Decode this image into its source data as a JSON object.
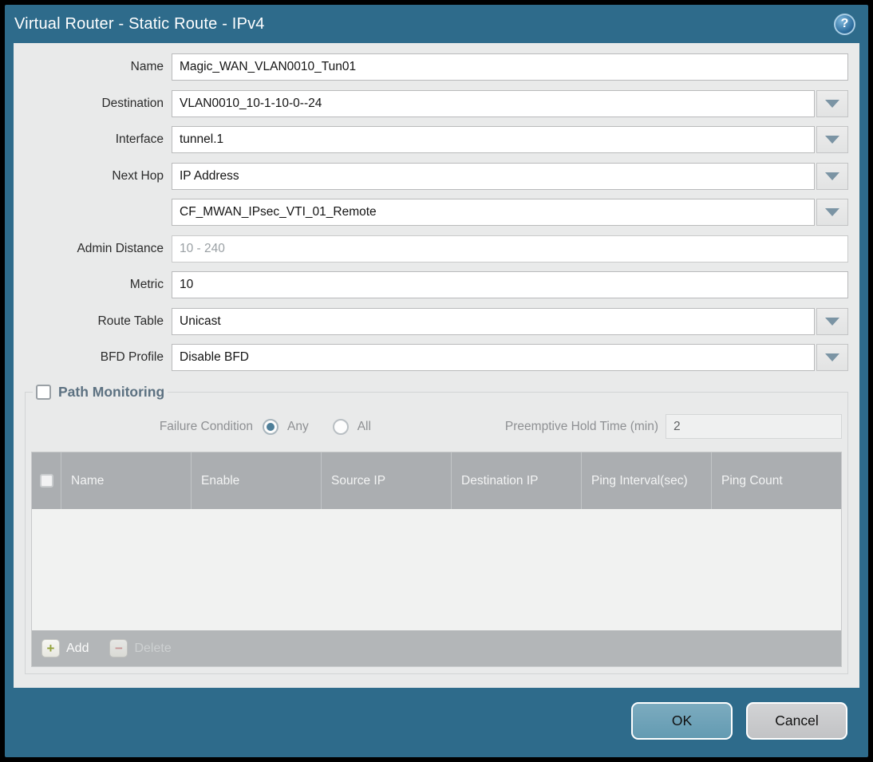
{
  "title_bar": {
    "title": "Virtual Router - Static Route - IPv4",
    "help_glyph": "?"
  },
  "form": {
    "name": {
      "label": "Name",
      "value": "Magic_WAN_VLAN0010_Tun01"
    },
    "destination": {
      "label": "Destination",
      "value": "VLAN0010_10-1-10-0--24"
    },
    "interface": {
      "label": "Interface",
      "value": "tunnel.1"
    },
    "next_hop": {
      "label": "Next Hop",
      "value": "IP Address"
    },
    "next_hop_value": {
      "value": "CF_MWAN_IPsec_VTI_01_Remote"
    },
    "admin_distance": {
      "label": "Admin Distance",
      "placeholder": "10 - 240"
    },
    "metric": {
      "label": "Metric",
      "value": "10"
    },
    "route_table": {
      "label": "Route Table",
      "value": "Unicast"
    },
    "bfd_profile": {
      "label": "BFD Profile",
      "value": "Disable BFD"
    }
  },
  "path_monitoring": {
    "title": "Path Monitoring",
    "enabled": false,
    "failure_condition": {
      "label": "Failure Condition",
      "options": [
        {
          "label": "Any",
          "selected": true
        },
        {
          "label": "All",
          "selected": false
        }
      ]
    },
    "preemptive_hold_time": {
      "label": "Preemptive Hold Time (min)",
      "value": "2"
    },
    "table": {
      "columns": [
        "Name",
        "Enable",
        "Source IP",
        "Destination IP",
        "Ping Interval(sec)",
        "Ping Count"
      ],
      "rows": []
    },
    "actions": {
      "add": "Add",
      "delete": "Delete"
    }
  },
  "footer": {
    "ok": "OK",
    "cancel": "Cancel"
  },
  "colors": {
    "frame_teal": "#2e6b8b",
    "content_gray": "#e9eaea",
    "table_header_gray": "#abaeb1",
    "ok_button_blue": "#6ca3ba",
    "radio_selected": "#4e7f99",
    "add_icon_green": "#93a23c",
    "delete_icon_red": "#d08f8f"
  }
}
